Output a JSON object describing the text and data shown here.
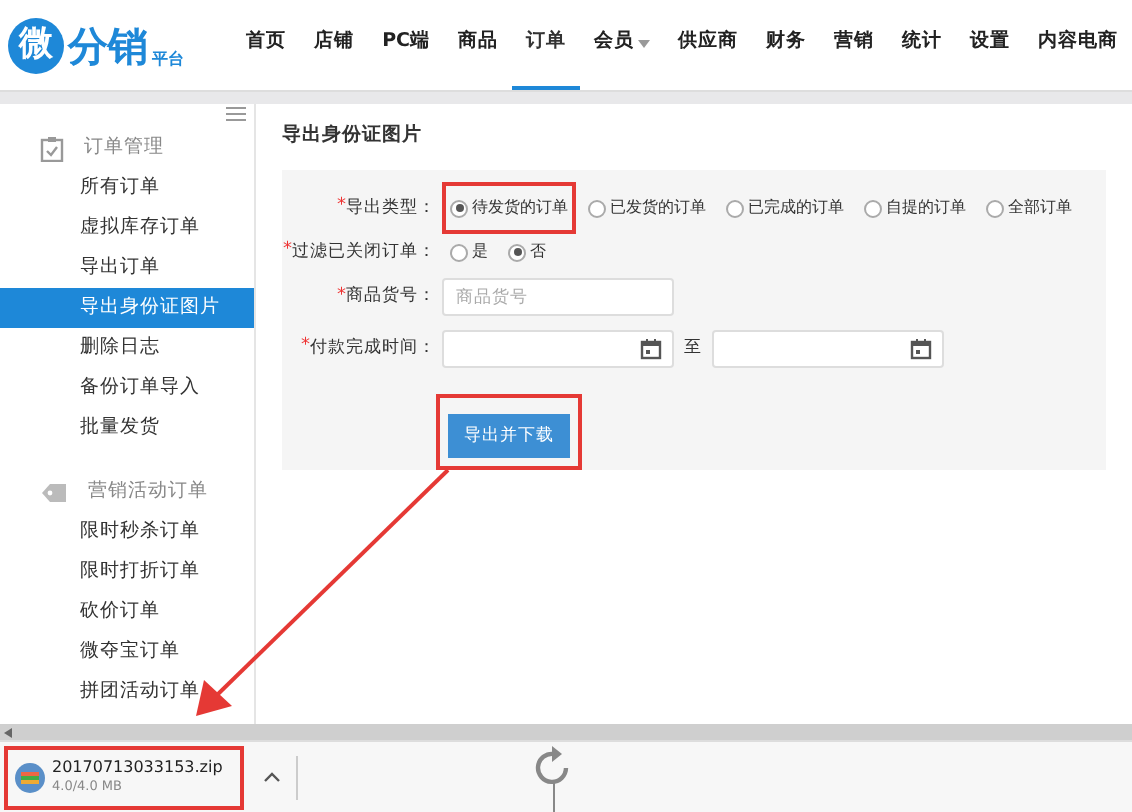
{
  "logo": {
    "mark": "微",
    "name": "分销",
    "sub": "平台"
  },
  "nav": [
    {
      "label": "首页",
      "selected": false,
      "dropdown": false
    },
    {
      "label": "店铺",
      "selected": false,
      "dropdown": false
    },
    {
      "label": "PC端",
      "selected": false,
      "dropdown": false
    },
    {
      "label": "商品",
      "selected": false,
      "dropdown": false
    },
    {
      "label": "订单",
      "selected": true,
      "dropdown": false
    },
    {
      "label": "会员",
      "selected": false,
      "dropdown": true
    },
    {
      "label": "供应商",
      "selected": false,
      "dropdown": false
    },
    {
      "label": "财务",
      "selected": false,
      "dropdown": false
    },
    {
      "label": "营销",
      "selected": false,
      "dropdown": false
    },
    {
      "label": "统计",
      "selected": false,
      "dropdown": false
    },
    {
      "label": "设置",
      "selected": false,
      "dropdown": false
    },
    {
      "label": "内容电商",
      "selected": false,
      "dropdown": false
    }
  ],
  "sidebar": {
    "groups": [
      {
        "title": "订单管理",
        "kind": "clipboard",
        "items": [
          {
            "label": "所有订单",
            "selected": false
          },
          {
            "label": "虚拟库存订单",
            "selected": false
          },
          {
            "label": "导出订单",
            "selected": false
          },
          {
            "label": "导出身份证图片",
            "selected": true
          },
          {
            "label": "删除日志",
            "selected": false
          },
          {
            "label": "备份订单导入",
            "selected": false
          },
          {
            "label": "批量发货",
            "selected": false
          }
        ]
      },
      {
        "title": "营销活动订单",
        "kind": "tag",
        "items": [
          {
            "label": "限时秒杀订单",
            "selected": false
          },
          {
            "label": "限时打折订单",
            "selected": false
          },
          {
            "label": "砍价订单",
            "selected": false
          },
          {
            "label": "微夺宝订单",
            "selected": false
          },
          {
            "label": "拼团活动订单",
            "selected": false
          }
        ]
      }
    ]
  },
  "form": {
    "title": "导出身份证图片",
    "rows": [
      {
        "kind": "radio",
        "label": "导出类型：",
        "marker": "*",
        "options": [
          {
            "label": "待发货的订单",
            "selected": true,
            "highlighted": true
          },
          {
            "label": "已发货的订单",
            "selected": false,
            "highlighted": false
          },
          {
            "label": "已完成的订单",
            "selected": false,
            "highlighted": false
          },
          {
            "label": "自提的订单",
            "selected": false,
            "highlighted": false
          },
          {
            "label": "全部订单",
            "selected": false,
            "highlighted": false
          }
        ]
      },
      {
        "kind": "radio",
        "label": "过滤已关闭订单：",
        "marker": "*",
        "options": [
          {
            "label": "是",
            "selected": false,
            "highlighted": false
          },
          {
            "label": "否",
            "selected": true,
            "highlighted": false
          }
        ]
      },
      {
        "kind": "text",
        "label": "商品货号：",
        "marker": "*",
        "placeholder": "商品货号"
      },
      {
        "kind": "daterange",
        "label": "付款完成时间：",
        "marker": "*",
        "separator": "至"
      }
    ],
    "button": {
      "label": "导出并下载",
      "highlighted": true
    }
  },
  "download": {
    "filename": "20170713033153.zip",
    "size": "4.0/4.0 MB",
    "highlighted": true
  }
}
